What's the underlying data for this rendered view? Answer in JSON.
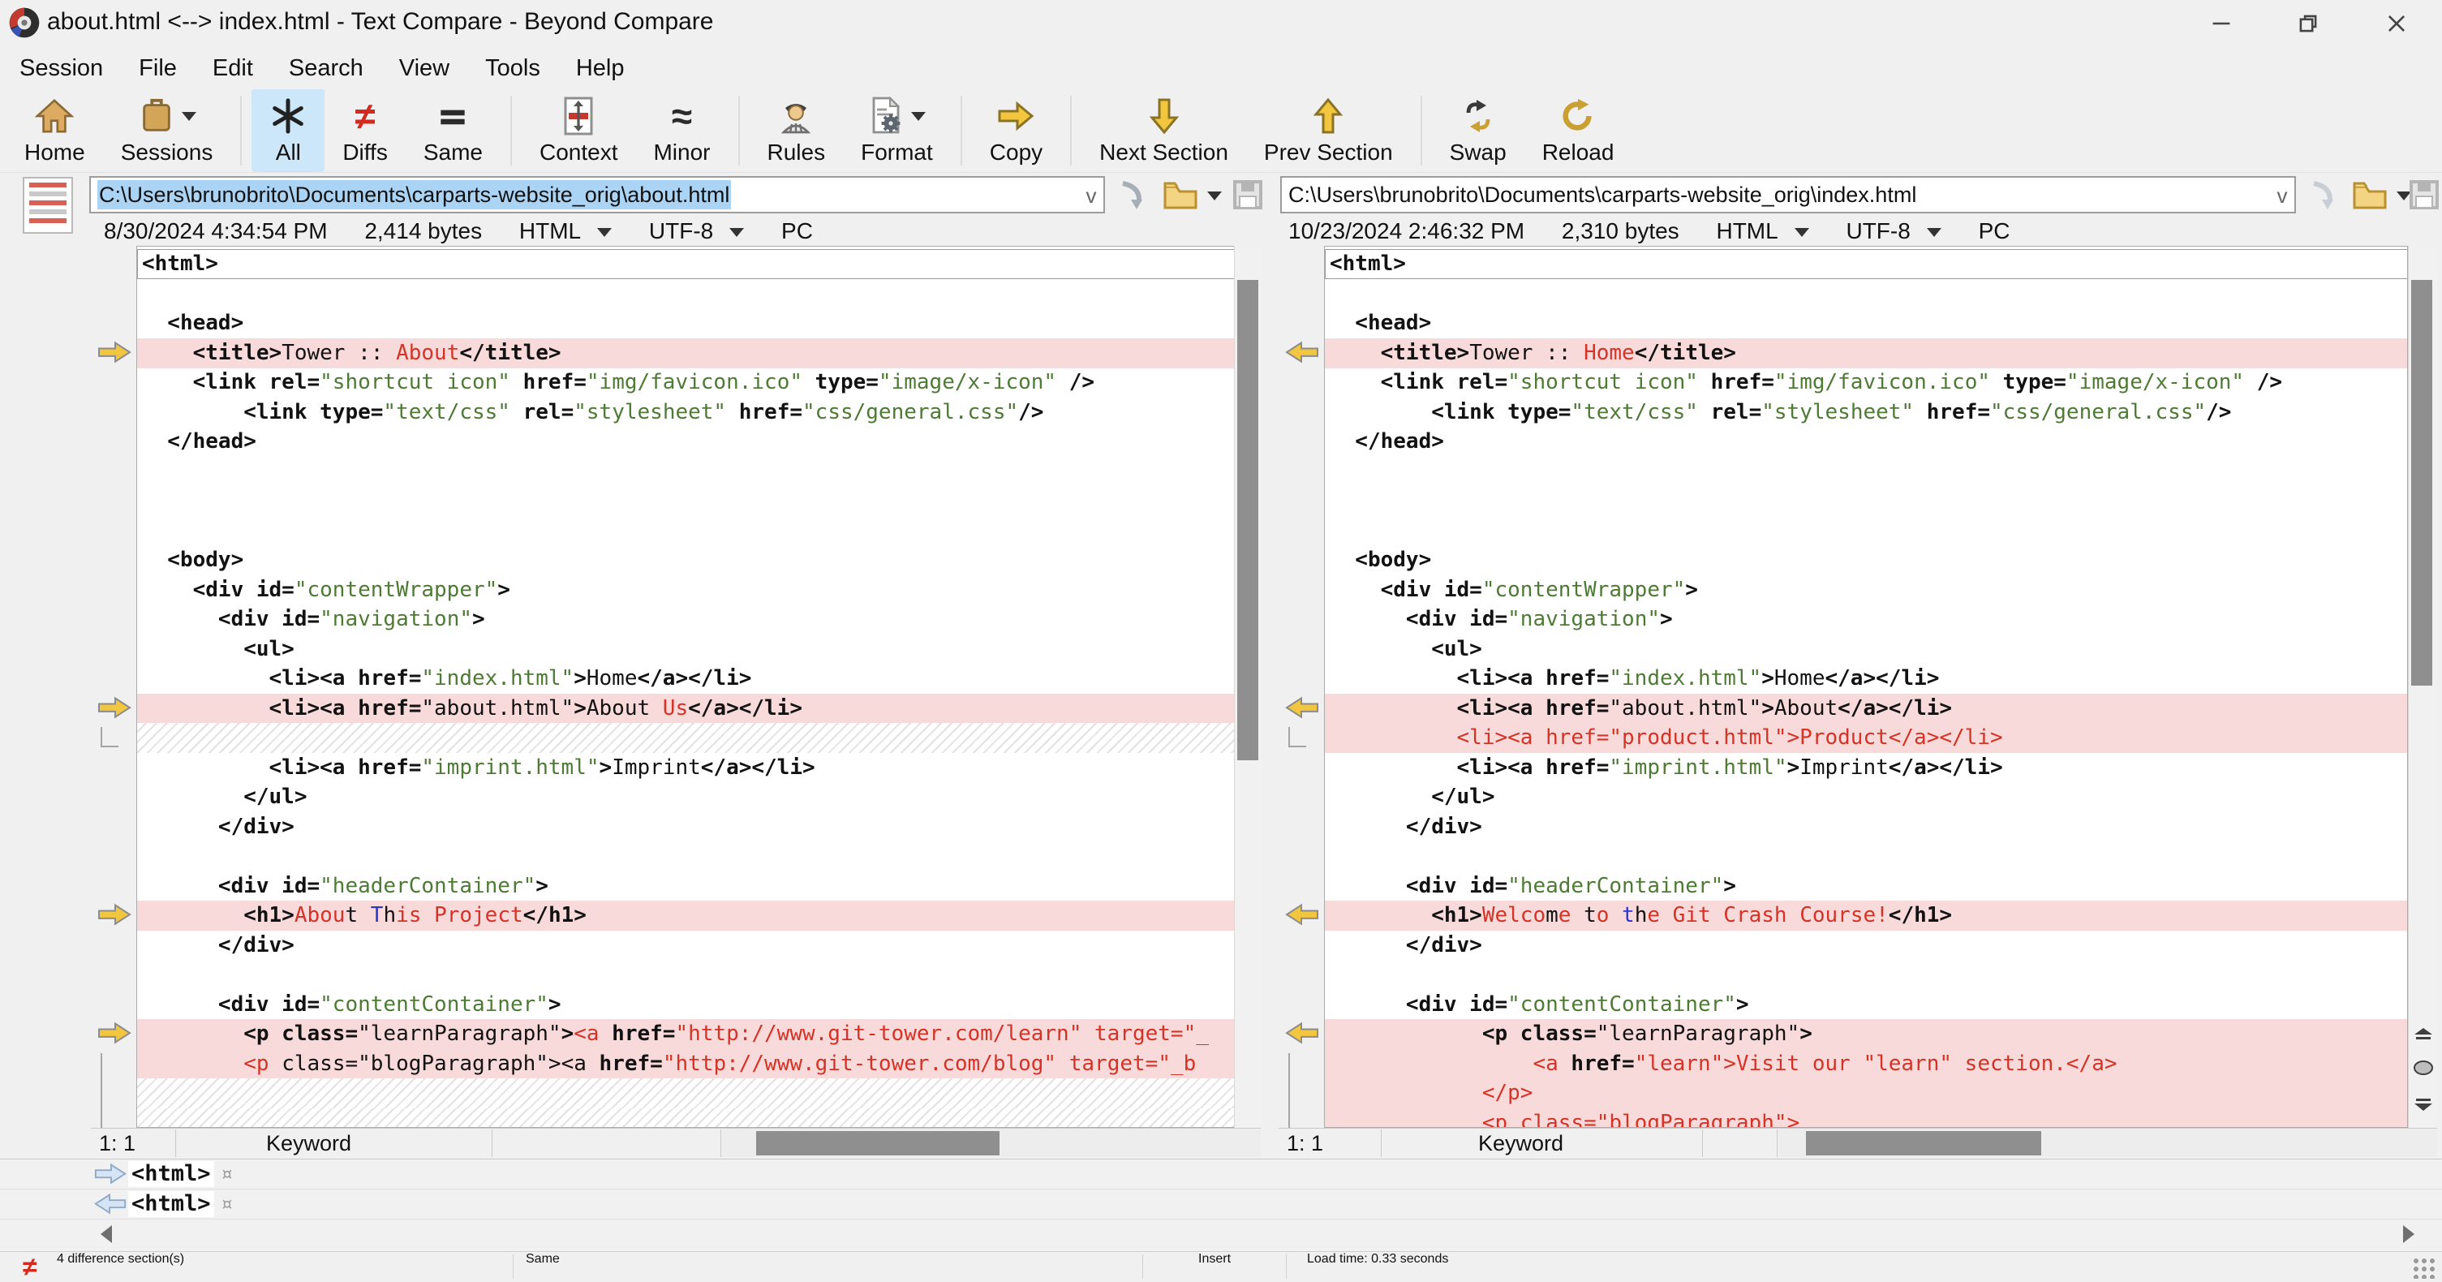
{
  "window": {
    "title": "about.html <--> index.html - Text Compare - Beyond Compare"
  },
  "menu": [
    "Session",
    "File",
    "Edit",
    "Search",
    "View",
    "Tools",
    "Help"
  ],
  "toolbar": [
    {
      "label": "Home",
      "icon": "home-icon"
    },
    {
      "label": "Sessions",
      "icon": "sessions-icon",
      "dropdown": true
    },
    {
      "sep": true
    },
    {
      "label": "All",
      "icon": "all-icon",
      "selected": true
    },
    {
      "label": "Diffs",
      "icon": "diffs-icon"
    },
    {
      "label": "Same",
      "icon": "same-icon"
    },
    {
      "sep": true
    },
    {
      "label": "Context",
      "icon": "context-icon"
    },
    {
      "label": "Minor",
      "icon": "minor-icon"
    },
    {
      "sep": true
    },
    {
      "label": "Rules",
      "icon": "rules-icon"
    },
    {
      "label": "Format",
      "icon": "format-icon",
      "dropdown": true
    },
    {
      "sep": true
    },
    {
      "label": "Copy",
      "icon": "copy-arrow-icon"
    },
    {
      "sep": true
    },
    {
      "label": "Next Section",
      "icon": "next-section-icon"
    },
    {
      "label": "Prev Section",
      "icon": "prev-section-icon"
    },
    {
      "sep": true
    },
    {
      "label": "Swap",
      "icon": "swap-icon"
    },
    {
      "label": "Reload",
      "icon": "reload-icon"
    }
  ],
  "paths": {
    "left": {
      "value": "C:\\Users\\brunobrito\\Documents\\carparts-website_orig\\about.html",
      "selected": true
    },
    "right": {
      "value": "C:\\Users\\brunobrito\\Documents\\carparts-website_orig\\index.html",
      "selected": false
    }
  },
  "fileinfo": {
    "left": {
      "date": "8/30/2024 4:34:54 PM",
      "size": "2,414 bytes",
      "format": "HTML",
      "encoding": "UTF-8",
      "lineending": "PC"
    },
    "right": {
      "date": "10/23/2024 2:46:32 PM",
      "size": "2,310 bytes",
      "format": "HTML",
      "encoding": "UTF-8",
      "lineending": "PC"
    }
  },
  "panes": {
    "left": {
      "status": {
        "cursor": "1: 1",
        "syntax": "Keyword"
      },
      "brackets": [
        {
          "from": 16,
          "to": 16,
          "foot": true
        },
        {
          "from": 27,
          "to": 29,
          "foot": false
        }
      ],
      "lines": [
        {
          "focus": true,
          "segs": [
            [
              "k",
              "<html>"
            ]
          ]
        },
        {
          "segs": []
        },
        {
          "segs": [
            [
              "k",
              "  <head>"
            ]
          ]
        },
        {
          "bg": "pink",
          "arrow": "right",
          "segs": [
            [
              "k",
              "    <title>"
            ],
            [
              "t",
              "Tower :: "
            ],
            [
              "r",
              "About"
            ],
            [
              "k",
              "</title>"
            ]
          ]
        },
        {
          "segs": [
            [
              "k",
              "    <link rel="
            ],
            [
              "s",
              "\"shortcut icon\""
            ],
            [
              "k",
              " href="
            ],
            [
              "s",
              "\"img/favicon.ico\""
            ],
            [
              "k",
              " type="
            ],
            [
              "s",
              "\"image/x-icon\""
            ],
            [
              "k",
              " />"
            ]
          ]
        },
        {
          "segs": [
            [
              "k",
              "        <link type="
            ],
            [
              "s",
              "\"text/css\""
            ],
            [
              "k",
              " rel="
            ],
            [
              "s",
              "\"stylesheet\""
            ],
            [
              "k",
              " href="
            ],
            [
              "s",
              "\"css/general.css\""
            ],
            [
              "k",
              "/>"
            ]
          ]
        },
        {
          "segs": [
            [
              "k",
              "  </head>"
            ]
          ]
        },
        {
          "segs": []
        },
        {
          "segs": []
        },
        {
          "segs": []
        },
        {
          "segs": [
            [
              "k",
              "  <body>"
            ]
          ]
        },
        {
          "segs": [
            [
              "k",
              "    <div id="
            ],
            [
              "s",
              "\"contentWrapper\""
            ],
            [
              "k",
              ">"
            ]
          ]
        },
        {
          "segs": [
            [
              "k",
              "      <div id="
            ],
            [
              "s",
              "\"navigation\""
            ],
            [
              "k",
              ">"
            ]
          ]
        },
        {
          "segs": [
            [
              "k",
              "        <ul>"
            ]
          ]
        },
        {
          "segs": [
            [
              "k",
              "          <li><a href="
            ],
            [
              "s",
              "\"index.html\""
            ],
            [
              "k",
              ">"
            ],
            [
              "t",
              "Home"
            ],
            [
              "k",
              "</a></li>"
            ]
          ]
        },
        {
          "bg": "pink",
          "arrow": "right",
          "segs": [
            [
              "k",
              "          <li><a href="
            ],
            [
              "t",
              "\"about.html\""
            ],
            [
              "k",
              ">"
            ],
            [
              "t",
              "About "
            ],
            [
              "r",
              "Us"
            ],
            [
              "k",
              "</a></li>"
            ]
          ]
        },
        {
          "hatch": true
        },
        {
          "segs": [
            [
              "k",
              "          <li><a href="
            ],
            [
              "s",
              "\"imprint.html\""
            ],
            [
              "k",
              ">"
            ],
            [
              "t",
              "Imprint"
            ],
            [
              "k",
              "</a></li>"
            ]
          ]
        },
        {
          "segs": [
            [
              "k",
              "        </ul>"
            ]
          ]
        },
        {
          "segs": [
            [
              "k",
              "      </div>"
            ]
          ]
        },
        {
          "segs": []
        },
        {
          "segs": [
            [
              "k",
              "      <div id="
            ],
            [
              "s",
              "\"headerContainer\""
            ],
            [
              "k",
              ">"
            ]
          ]
        },
        {
          "bg": "pink",
          "arrow": "right",
          "segs": [
            [
              "k",
              "        <h1>"
            ],
            [
              "r",
              "Abou"
            ],
            [
              "t",
              "t"
            ],
            [
              "r",
              " "
            ],
            [
              "b",
              "T"
            ],
            [
              "t",
              "h"
            ],
            [
              "r",
              "is Project"
            ],
            [
              "k",
              "</h1>"
            ]
          ]
        },
        {
          "segs": [
            [
              "k",
              "      </div>"
            ]
          ]
        },
        {
          "segs": []
        },
        {
          "segs": [
            [
              "k",
              "      <div id="
            ],
            [
              "s",
              "\"contentContainer\""
            ],
            [
              "k",
              ">"
            ]
          ]
        },
        {
          "bg": "pink",
          "arrow": "right",
          "segs": [
            [
              "k",
              "        <p class="
            ],
            [
              "t",
              "\"learnParagraph\""
            ],
            [
              "k",
              ">"
            ],
            [
              "r",
              "<a"
            ],
            [
              "k",
              " href="
            ],
            [
              "r",
              "\"http://www.git-tower.com/learn\""
            ],
            [
              "r",
              " target=\"_"
            ]
          ]
        },
        {
          "bg": "pink",
          "segs": [
            [
              "t",
              "        "
            ],
            [
              "r",
              "<p "
            ],
            [
              "t",
              "class=\"blogParagraph\">"
            ],
            [
              "t",
              "<a "
            ],
            [
              "k",
              "href="
            ],
            [
              "r",
              "\"http://www.git-tower.com/blog\""
            ],
            [
              "r",
              " target=\"_b"
            ]
          ]
        },
        {
          "hatch": true
        },
        {
          "hatch": true
        }
      ]
    },
    "right": {
      "status": {
        "cursor": "1: 1",
        "syntax": "Keyword"
      },
      "brackets": [
        {
          "from": 16,
          "to": 16,
          "foot": true
        },
        {
          "from": 27,
          "to": 29,
          "foot": false
        }
      ],
      "lines": [
        {
          "focus": true,
          "segs": [
            [
              "k",
              "<html>"
            ]
          ]
        },
        {
          "segs": []
        },
        {
          "segs": [
            [
              "k",
              "  <head>"
            ]
          ]
        },
        {
          "bg": "pink",
          "arrow": "left",
          "segs": [
            [
              "k",
              "    <title>"
            ],
            [
              "t",
              "Tower :: "
            ],
            [
              "r",
              "Home"
            ],
            [
              "k",
              "</title>"
            ]
          ]
        },
        {
          "segs": [
            [
              "k",
              "    <link rel="
            ],
            [
              "s",
              "\"shortcut icon\""
            ],
            [
              "k",
              " href="
            ],
            [
              "s",
              "\"img/favicon.ico\""
            ],
            [
              "k",
              " type="
            ],
            [
              "s",
              "\"image/x-icon\""
            ],
            [
              "k",
              " />"
            ]
          ]
        },
        {
          "segs": [
            [
              "k",
              "        <link type="
            ],
            [
              "s",
              "\"text/css\""
            ],
            [
              "k",
              " rel="
            ],
            [
              "s",
              "\"stylesheet\""
            ],
            [
              "k",
              " href="
            ],
            [
              "s",
              "\"css/general.css\""
            ],
            [
              "k",
              "/>"
            ]
          ]
        },
        {
          "segs": [
            [
              "k",
              "  </head>"
            ]
          ]
        },
        {
          "segs": []
        },
        {
          "segs": []
        },
        {
          "segs": []
        },
        {
          "segs": [
            [
              "k",
              "  <body>"
            ]
          ]
        },
        {
          "segs": [
            [
              "k",
              "    <div id="
            ],
            [
              "s",
              "\"contentWrapper\""
            ],
            [
              "k",
              ">"
            ]
          ]
        },
        {
          "segs": [
            [
              "k",
              "      <div id="
            ],
            [
              "s",
              "\"navigation\""
            ],
            [
              "k",
              ">"
            ]
          ]
        },
        {
          "segs": [
            [
              "k",
              "        <ul>"
            ]
          ]
        },
        {
          "segs": [
            [
              "k",
              "          <li><a href="
            ],
            [
              "s",
              "\"index.html\""
            ],
            [
              "k",
              ">"
            ],
            [
              "t",
              "Home"
            ],
            [
              "k",
              "</a></li>"
            ]
          ]
        },
        {
          "bg": "pink",
          "arrow": "left",
          "segs": [
            [
              "k",
              "          <li><a href="
            ],
            [
              "t",
              "\"about.html\""
            ],
            [
              "k",
              ">"
            ],
            [
              "t",
              "About"
            ],
            [
              "k",
              "</a></li>"
            ]
          ]
        },
        {
          "bg": "pink",
          "segs": [
            [
              "r",
              "          <li><a href=\"product.html\">Product</a></li>"
            ]
          ]
        },
        {
          "segs": [
            [
              "k",
              "          <li><a href="
            ],
            [
              "s",
              "\"imprint.html\""
            ],
            [
              "k",
              ">"
            ],
            [
              "t",
              "Imprint"
            ],
            [
              "k",
              "</a></li>"
            ]
          ]
        },
        {
          "segs": [
            [
              "k",
              "        </ul>"
            ]
          ]
        },
        {
          "segs": [
            [
              "k",
              "      </div>"
            ]
          ]
        },
        {
          "segs": []
        },
        {
          "segs": [
            [
              "k",
              "      <div id="
            ],
            [
              "s",
              "\"headerContainer\""
            ],
            [
              "k",
              ">"
            ]
          ]
        },
        {
          "bg": "pink",
          "arrow": "left",
          "segs": [
            [
              "k",
              "        <h1>"
            ],
            [
              "r",
              "Welco"
            ],
            [
              "t",
              "m"
            ],
            [
              "r",
              "e "
            ],
            [
              "t",
              "t"
            ],
            [
              "r",
              "o "
            ],
            [
              "b",
              "t"
            ],
            [
              "t",
              "h"
            ],
            [
              "r",
              "e Git Crash Course!"
            ],
            [
              "k",
              "</h1>"
            ]
          ]
        },
        {
          "segs": [
            [
              "k",
              "      </div>"
            ]
          ]
        },
        {
          "segs": []
        },
        {
          "segs": [
            [
              "k",
              "      <div id="
            ],
            [
              "s",
              "\"contentContainer\""
            ],
            [
              "k",
              ">"
            ]
          ]
        },
        {
          "bg": "pink",
          "arrow": "left",
          "segs": [
            [
              "k",
              "            <p class="
            ],
            [
              "t",
              "\"learnParagraph\""
            ],
            [
              "k",
              ">"
            ]
          ]
        },
        {
          "bg": "pink",
          "segs": [
            [
              "r",
              "                <a"
            ],
            [
              "k",
              " href="
            ],
            [
              "r",
              "\"learn\">Visit our \"learn\" section.</a>"
            ]
          ]
        },
        {
          "bg": "pink",
          "segs": [
            [
              "r",
              "            </p>"
            ]
          ]
        },
        {
          "bg": "pink",
          "segs": [
            [
              "r",
              "            <p class=\"blogParagraph\">"
            ]
          ]
        }
      ]
    }
  },
  "details": [
    {
      "arrow": "right",
      "text": "<html>",
      "eol": "¤"
    },
    {
      "arrow": "left",
      "text": "<html>",
      "eol": "¤"
    }
  ],
  "statusbar": {
    "diff_glyph": "≠",
    "sections": "4 difference section(s)",
    "comparison": "Same",
    "mode": "Insert",
    "load_time": "Load time: 0.33 seconds"
  },
  "colors": {
    "diff_row_bg": "#f9dada",
    "diff_text": "#d63327",
    "minor_diff_text": "#2a35cf",
    "string_green": "#4e7b34",
    "selection_blue": "#abd3f3",
    "arrow_gold": "#f3c63f",
    "toolbar_selected_bg": "#cde7fa"
  }
}
